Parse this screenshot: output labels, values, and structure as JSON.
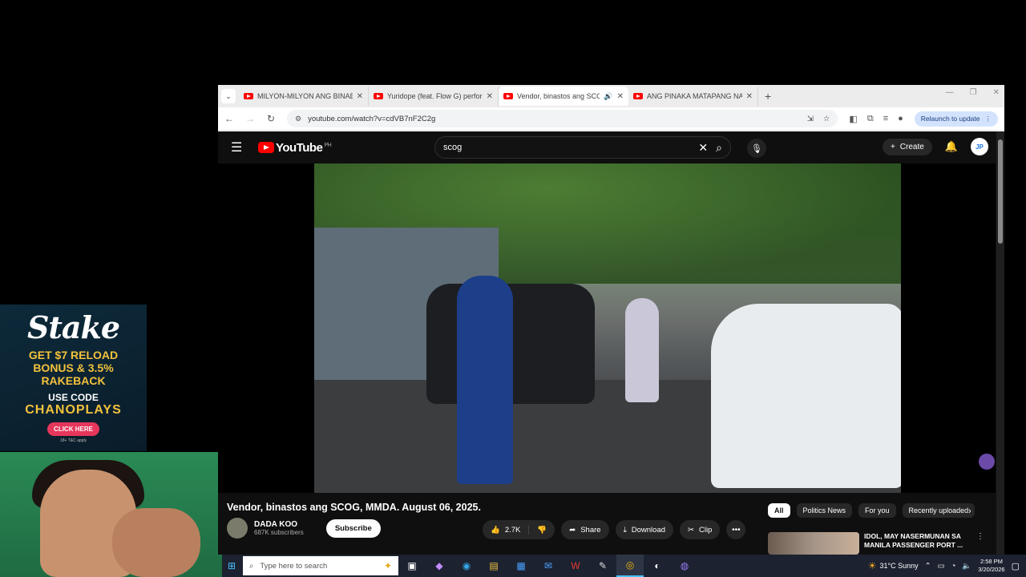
{
  "ad": {
    "logo": "Stake",
    "promo_line1": "GET $7 RELOAD",
    "promo_line2": "BONUS & 3.5%",
    "promo_line3": "RAKEBACK",
    "use_code": "USE CODE",
    "code": "CHANOPLAYS",
    "cta": "CLICK HERE",
    "fine_print": "18+ T&C apply"
  },
  "browser": {
    "tabs": [
      {
        "title": "MILYON-MILYON ANG BINABA..."
      },
      {
        "title": "Yuridope (feat. Flow G) perform..."
      },
      {
        "title": "Vendor, binastos ang SCOG...",
        "active": true
      },
      {
        "title": "ANG PINAKA MATAPANG NA B..."
      }
    ],
    "new_tab": "+",
    "url": "youtube.com/watch?v=cdVB7nF2C2g",
    "relaunch_label": "Relaunch to update"
  },
  "youtube": {
    "logo_text": "YouTube",
    "region": "PH",
    "search_query": "scog",
    "create_label": "Create",
    "avatar_initials": "JP",
    "video_title": "Vendor, binastos ang SCOG, MMDA. August 06, 2025.",
    "channel_name": "DADA KOO",
    "channel_subs": "687K subscribers",
    "subscribe_label": "Subscribe",
    "likes": "2.7K",
    "share_label": "Share",
    "download_label": "Download",
    "clip_label": "Clip",
    "chips": [
      "All",
      "Politics News",
      "For you",
      "Recently uploaded"
    ],
    "recommended": {
      "title_line1": "IDOL, MAY NASERMUNAN SA",
      "title_line2": "MANILA PASSENGER PORT ..."
    }
  },
  "taskbar": {
    "search_placeholder": "Type here to search",
    "weather": "31°C  Sunny",
    "time": "2:58 PM",
    "date": "3/20/2026"
  }
}
